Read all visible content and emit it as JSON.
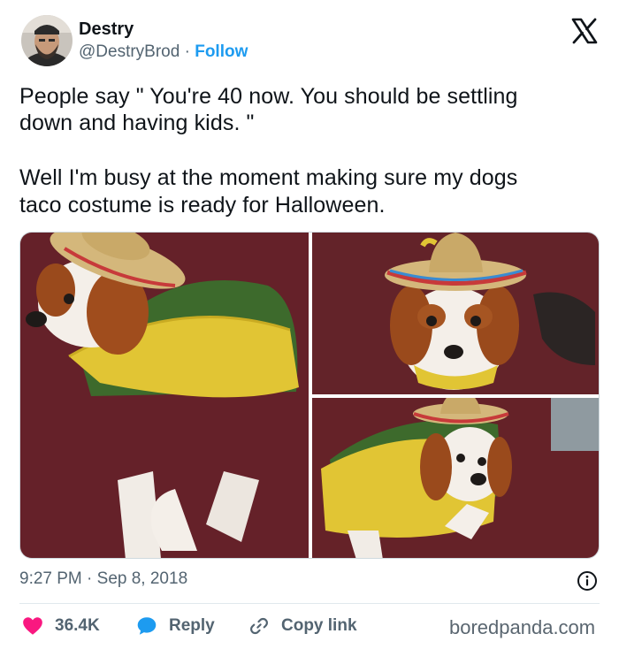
{
  "author": {
    "name": "Destry",
    "handle": "@DestryBrod",
    "separator": "·",
    "follow_label": "Follow"
  },
  "tweet": {
    "lines": [
      "People say \" You're 40 now. You should be settling",
      "down and having kids. \"",
      "Well I'm busy at the moment making sure my dogs",
      "taco costume is ready for Halloween."
    ]
  },
  "timestamp": {
    "time": "9:27 PM",
    "separator": "·",
    "date": "Sep 8, 2018"
  },
  "actions": {
    "likes": "36.4K",
    "reply_label": "Reply",
    "copy_label": "Copy link"
  },
  "watermark": "boredpanda.com",
  "icons": {
    "platform": "x-logo-icon",
    "like": "heart-icon",
    "reply": "speech-bubble-icon",
    "copy": "link-icon",
    "info": "info-icon"
  },
  "colors": {
    "accent": "#1d9bf0",
    "like": "#f91880",
    "secondary_text": "#536471",
    "text": "#0f1419"
  }
}
